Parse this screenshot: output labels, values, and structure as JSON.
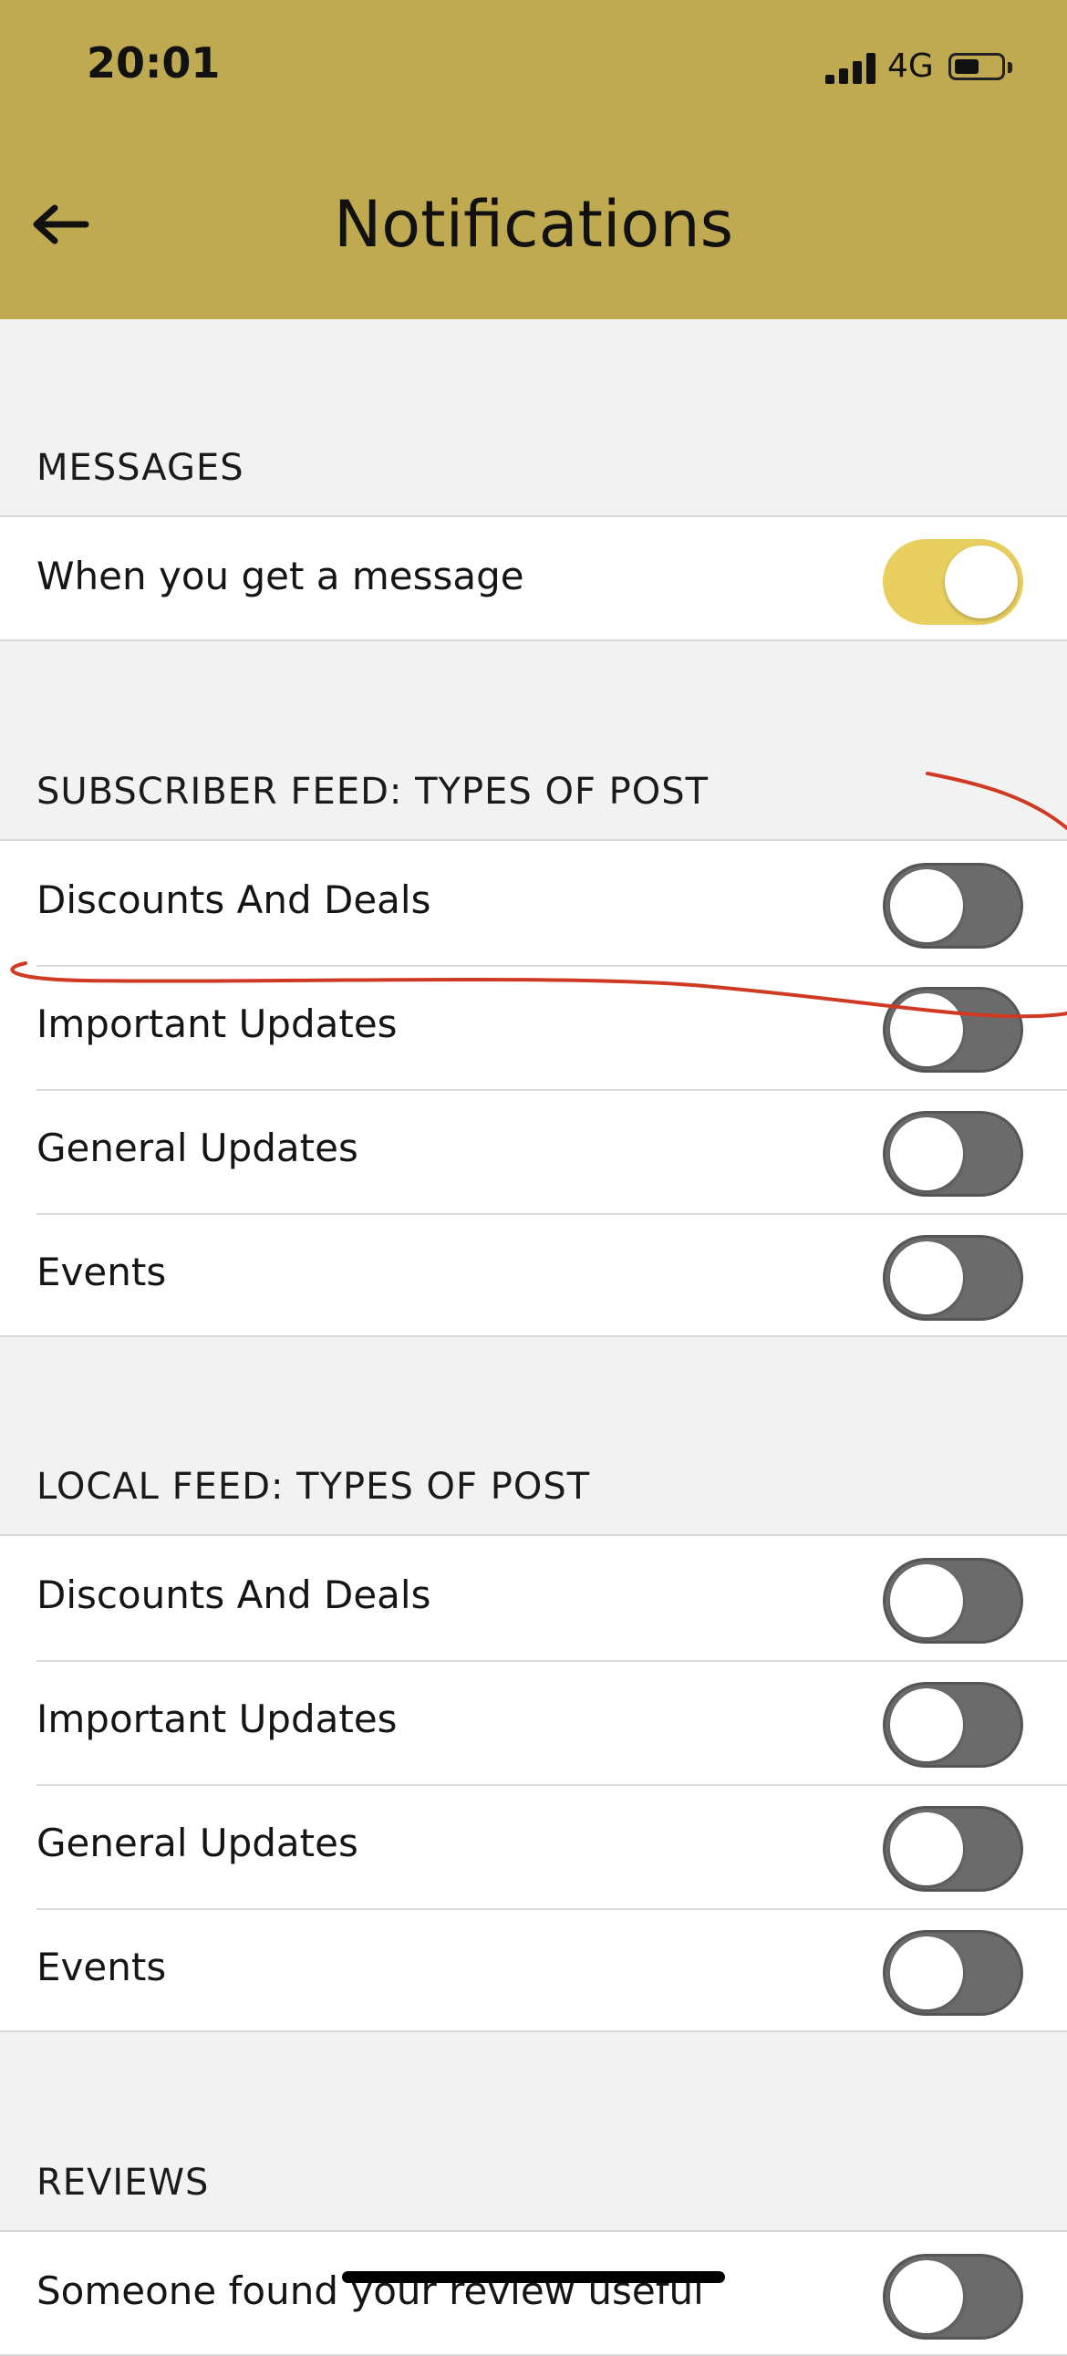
{
  "status_bar": {
    "time": "20:01",
    "network": "4G",
    "battery_level": 0.5
  },
  "header": {
    "title": "Notifications",
    "background_color": "#bfaa52"
  },
  "sections": [
    {
      "title": "MESSAGES",
      "items": [
        {
          "label": "When you get a message",
          "enabled": true
        }
      ]
    },
    {
      "title": "SUBSCRIBER FEED: TYPES OF POST",
      "items": [
        {
          "label": "Discounts And Deals",
          "enabled": false
        },
        {
          "label": "Important Updates",
          "enabled": false
        },
        {
          "label": "General Updates",
          "enabled": false
        },
        {
          "label": "Events",
          "enabled": false
        }
      ]
    },
    {
      "title": "LOCAL FEED: TYPES OF POST",
      "items": [
        {
          "label": "Discounts And Deals",
          "enabled": false
        },
        {
          "label": "Important Updates",
          "enabled": false
        },
        {
          "label": "General Updates",
          "enabled": false
        },
        {
          "label": "Events",
          "enabled": false
        }
      ]
    },
    {
      "title": "REVIEWS",
      "items": [
        {
          "label": "Someone found your review useful",
          "enabled": false
        }
      ]
    }
  ],
  "colors": {
    "toggle_on": "#e8cf5f",
    "toggle_off": "#6b6b6b",
    "annotation": "#d03a22"
  }
}
